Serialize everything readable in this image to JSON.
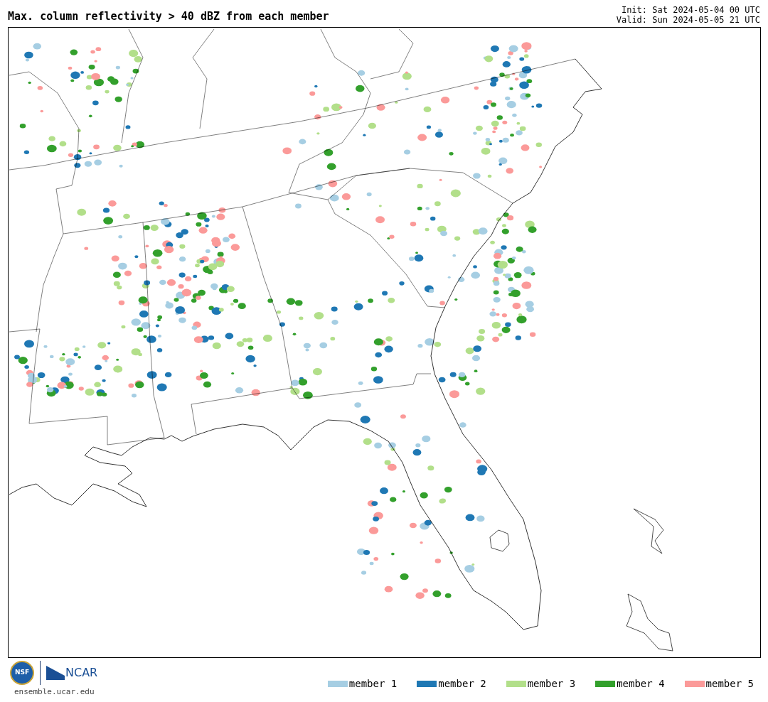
{
  "title": "Max. column reflectivity > 40 dBZ from each member",
  "init": "Init: Sat 2024-05-04 00 UTC",
  "valid": "Valid: Sun 2024-05-05 21 UTC",
  "footer": {
    "nsf_logo": "NSF",
    "ncar_logo": "NCAR",
    "site": "ensemble.ucar.edu"
  },
  "legend": [
    {
      "label": "member 1",
      "color": "#a6cee3"
    },
    {
      "label": "member 2",
      "color": "#1f78b4"
    },
    {
      "label": "member 3",
      "color": "#b2df8a"
    },
    {
      "label": "member 4",
      "color": "#33a02c"
    },
    {
      "label": "member 5",
      "color": "#fb9a99"
    }
  ]
}
